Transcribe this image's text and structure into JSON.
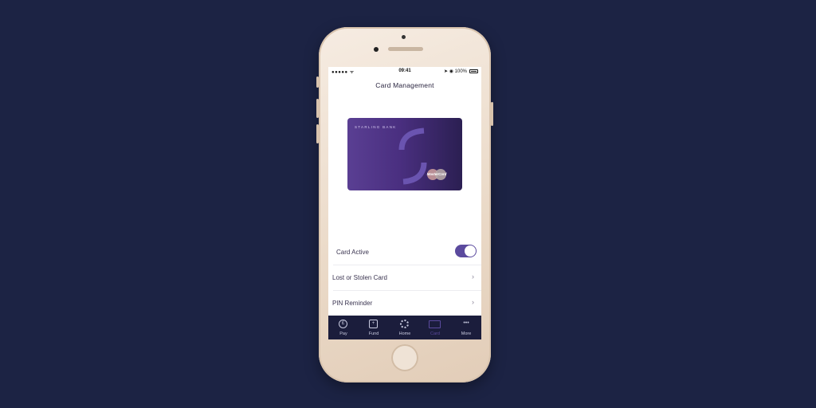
{
  "status_bar": {
    "signal": "●●●●● ᯤ",
    "time": "09:41",
    "right": "➤ ◉ 100%"
  },
  "header": {
    "title": "Card Management"
  },
  "card": {
    "brand": "STARLING BANK",
    "network": "MasterCard",
    "colors": {
      "card_start": "#5a3f93",
      "card_end": "#2b1f52",
      "mc_red": "#c89a9a",
      "mc_yellow": "#b5a6a6"
    }
  },
  "settings": {
    "card_active": {
      "label": "Card Active",
      "enabled": true
    },
    "lost_stolen": {
      "label": "Lost or Stolen Card",
      "chevron": "›"
    },
    "pin_reminder": {
      "label": "PIN Reminder",
      "chevron": "›"
    }
  },
  "tabbar": {
    "tabs": [
      {
        "label": "Pay",
        "icon": "pound-icon",
        "glyph": "£",
        "active": false
      },
      {
        "label": "Fund",
        "icon": "plus-icon",
        "glyph": "+",
        "active": false
      },
      {
        "label": "Home",
        "icon": "home-circle-icon",
        "glyph": "",
        "active": false
      },
      {
        "label": "Card",
        "icon": "card-icon",
        "glyph": "",
        "active": true
      },
      {
        "label": "More",
        "icon": "more-dots-icon",
        "glyph": "•••",
        "active": false
      }
    ],
    "accent": "#5b4a9e"
  }
}
